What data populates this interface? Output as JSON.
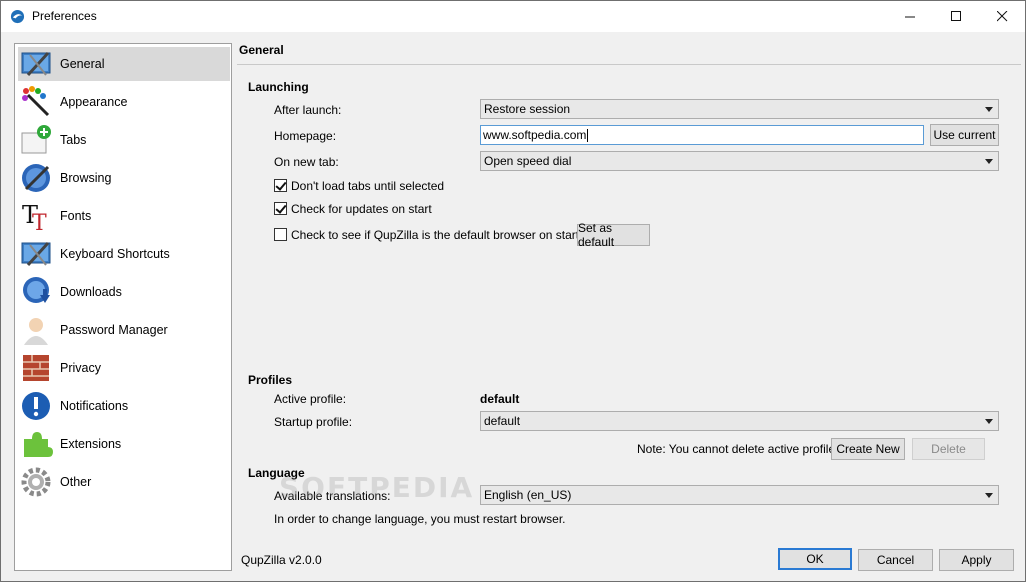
{
  "window": {
    "title": "Preferences",
    "controls": {
      "minimize": "—",
      "maximize": "☐",
      "close": "✕"
    }
  },
  "sidebar": {
    "items": [
      {
        "label": "General",
        "icon": "general-icon",
        "selected": true
      },
      {
        "label": "Appearance",
        "icon": "appearance-icon"
      },
      {
        "label": "Tabs",
        "icon": "tabs-icon"
      },
      {
        "label": "Browsing",
        "icon": "browsing-icon"
      },
      {
        "label": "Fonts",
        "icon": "fonts-icon"
      },
      {
        "label": "Keyboard Shortcuts",
        "icon": "keyboard-shortcuts-icon"
      },
      {
        "label": "Downloads",
        "icon": "downloads-icon"
      },
      {
        "label": "Password Manager",
        "icon": "password-manager-icon"
      },
      {
        "label": "Privacy",
        "icon": "privacy-icon"
      },
      {
        "label": "Notifications",
        "icon": "notifications-icon"
      },
      {
        "label": "Extensions",
        "icon": "extensions-icon"
      },
      {
        "label": "Other",
        "icon": "other-icon"
      }
    ]
  },
  "page": {
    "title": "General",
    "launching": {
      "heading": "Launching",
      "after_launch_label": "After launch:",
      "after_launch_value": "Restore session",
      "homepage_label": "Homepage:",
      "homepage_value": "www.softpedia.com",
      "use_current_label": "Use current",
      "new_tab_label": "On new tab:",
      "new_tab_value": "Open speed dial",
      "dont_load_tabs_label": "Don't load tabs until selected",
      "dont_load_tabs_checked": true,
      "check_updates_label": "Check for updates on start",
      "check_updates_checked": true,
      "default_browser_label": "Check to see if QupZilla is the default browser on startup",
      "default_browser_checked": false,
      "set_default_label": "Set as default"
    },
    "profiles": {
      "heading": "Profiles",
      "active_label": "Active profile:",
      "active_value": "default",
      "startup_label": "Startup profile:",
      "startup_value": "default",
      "note": "Note: You cannot delete active profile.",
      "create_new_label": "Create New",
      "delete_label": "Delete"
    },
    "language": {
      "heading": "Language",
      "translations_label": "Available translations:",
      "translations_value": "English (en_US)",
      "restart_note": "In order to change language, you must restart browser."
    }
  },
  "footer": {
    "version": "QupZilla v2.0.0",
    "ok_label": "OK",
    "cancel_label": "Cancel",
    "apply_label": "Apply"
  },
  "watermark": "SOFTPEDIA"
}
